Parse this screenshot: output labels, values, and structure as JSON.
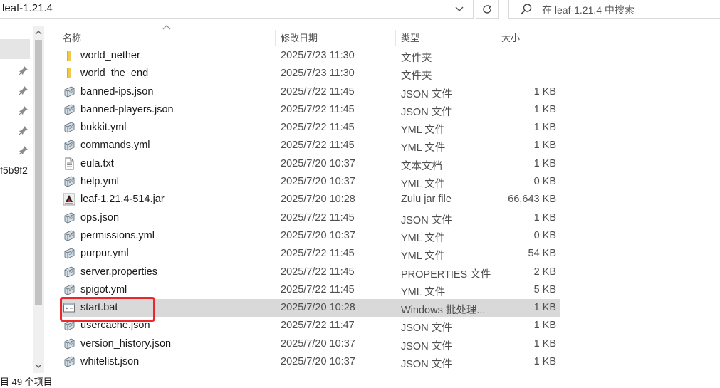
{
  "address_bar": {
    "path": "leaf-1.21.4"
  },
  "search": {
    "placeholder": "在 leaf-1.21.4 中搜索"
  },
  "nav": {
    "partial_text": "f5b9f2"
  },
  "columns": {
    "name": "名称",
    "date": "修改日期",
    "type": "类型",
    "size": "大小"
  },
  "files": [
    {
      "name": "world_nether",
      "date": "2025/7/23 11:30",
      "type": "文件夹",
      "size": "",
      "icon": "folder-icon"
    },
    {
      "name": "world_the_end",
      "date": "2025/7/23 11:30",
      "type": "文件夹",
      "size": "",
      "icon": "folder-icon"
    },
    {
      "name": "banned-ips.json",
      "date": "2025/7/22 11:45",
      "type": "JSON 文件",
      "size": "1 KB",
      "icon": "file-icon"
    },
    {
      "name": "banned-players.json",
      "date": "2025/7/22 11:45",
      "type": "JSON 文件",
      "size": "1 KB",
      "icon": "file-icon"
    },
    {
      "name": "bukkit.yml",
      "date": "2025/7/22 11:45",
      "type": "YML 文件",
      "size": "1 KB",
      "icon": "file-icon"
    },
    {
      "name": "commands.yml",
      "date": "2025/7/22 11:45",
      "type": "YML 文件",
      "size": "1 KB",
      "icon": "file-icon"
    },
    {
      "name": "eula.txt",
      "date": "2025/7/20 10:37",
      "type": "文本文档",
      "size": "1 KB",
      "icon": "text-file-icon"
    },
    {
      "name": "help.yml",
      "date": "2025/7/20 10:37",
      "type": "YML 文件",
      "size": "0 KB",
      "icon": "file-icon"
    },
    {
      "name": "leaf-1.21.4-514.jar",
      "date": "2025/7/20 10:28",
      "type": "Zulu jar file",
      "size": "66,643 KB",
      "icon": "jar-icon"
    },
    {
      "name": "ops.json",
      "date": "2025/7/22 11:45",
      "type": "JSON 文件",
      "size": "1 KB",
      "icon": "file-icon"
    },
    {
      "name": "permissions.yml",
      "date": "2025/7/20 10:37",
      "type": "YML 文件",
      "size": "0 KB",
      "icon": "file-icon"
    },
    {
      "name": "purpur.yml",
      "date": "2025/7/22 11:45",
      "type": "YML 文件",
      "size": "54 KB",
      "icon": "file-icon"
    },
    {
      "name": "server.properties",
      "date": "2025/7/22 11:45",
      "type": "PROPERTIES 文件",
      "size": "2 KB",
      "icon": "file-icon"
    },
    {
      "name": "spigot.yml",
      "date": "2025/7/22 11:45",
      "type": "YML 文件",
      "size": "5 KB",
      "icon": "file-icon"
    },
    {
      "name": "start.bat",
      "date": "2025/7/20 10:28",
      "type": "Windows 批处理...",
      "size": "1 KB",
      "icon": "batch-file-icon",
      "selected": true
    },
    {
      "name": "usercache.json",
      "date": "2025/7/22 11:47",
      "type": "JSON 文件",
      "size": "1 KB",
      "icon": "file-icon"
    },
    {
      "name": "version_history.json",
      "date": "2025/7/20 10:37",
      "type": "JSON 文件",
      "size": "1 KB",
      "icon": "file-icon"
    },
    {
      "name": "whitelist.json",
      "date": "2025/7/20 10:37",
      "type": "JSON 文件",
      "size": "1 KB",
      "icon": "file-icon"
    }
  ],
  "status_bar": {
    "item_count": "目 49 个项目"
  },
  "colors": {
    "highlight": "#e8282d",
    "selected_row": "#d9d9d9",
    "folder": "#f2c94c"
  }
}
